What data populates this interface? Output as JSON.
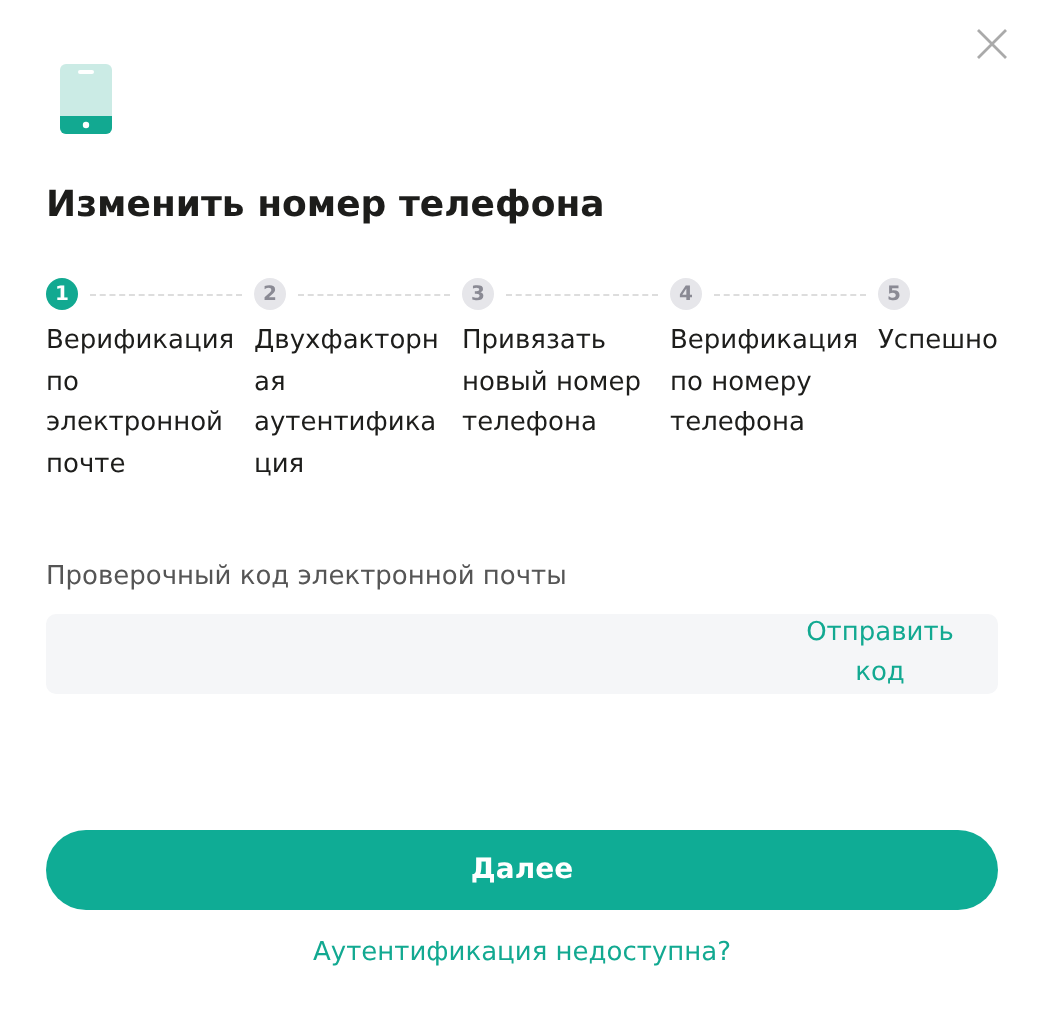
{
  "title": "Изменить номер телефона",
  "steps": [
    {
      "number": "1",
      "label": "Верификация по электронной почте",
      "selected": true
    },
    {
      "number": "2",
      "label": "Двухфакторная аутентификация",
      "selected": false
    },
    {
      "number": "3",
      "label": "Привязать новый номер телефона",
      "selected": false
    },
    {
      "number": "4",
      "label": "Верификация по номеру телефона",
      "selected": false
    },
    {
      "number": "5",
      "label": "Успешно",
      "selected": false
    }
  ],
  "code_field": {
    "label": "Проверочный код электронной почты",
    "action": "Отправить код"
  },
  "primary_button": "Далее",
  "help_link": "Аутентификация недоступна?"
}
